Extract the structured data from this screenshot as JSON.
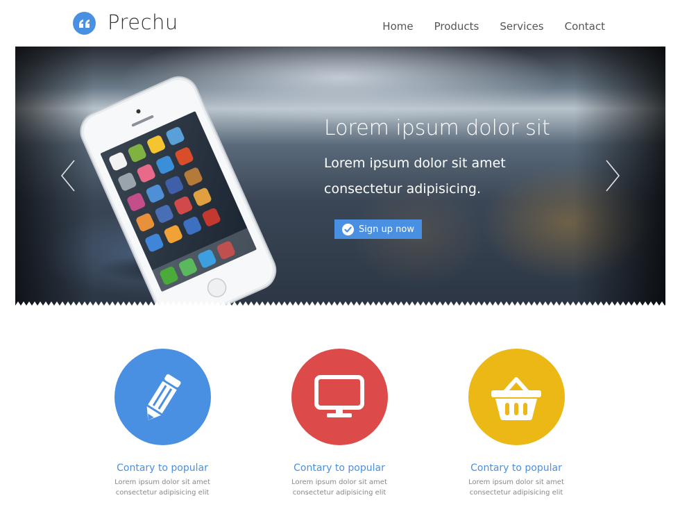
{
  "header": {
    "brand": "Prechu",
    "nav": [
      {
        "label": "Home"
      },
      {
        "label": "Products"
      },
      {
        "label": "Services"
      },
      {
        "label": "Contact"
      }
    ]
  },
  "hero": {
    "title": "Lorem ipsum dolor sit",
    "subtitle": "Lorem ipsum dolor sit amet consectetur adipisicing.",
    "button_label": "Sign up now",
    "button_icon": "check-circle-icon",
    "prev_icon": "chevron-left-icon",
    "next_icon": "chevron-right-icon"
  },
  "features": [
    {
      "icon": "pencil-icon",
      "color": "#4a90e2",
      "title": "Contary to popular",
      "desc": "Lorem ipsum dolor sit amet consectetur adipisicing elit"
    },
    {
      "icon": "monitor-icon",
      "color": "#dc4a4a",
      "title": "Contary to popular",
      "desc": "Lorem ipsum dolor sit amet consectetur adipisicing elit"
    },
    {
      "icon": "basket-icon",
      "color": "#ebb816",
      "title": "Contary to popular",
      "desc": "Lorem ipsum dolor sit amet consectetur adipisicing elit"
    }
  ],
  "colors": {
    "accent": "#4a90e2",
    "red": "#dc4a4a",
    "yellow": "#ebb816"
  }
}
